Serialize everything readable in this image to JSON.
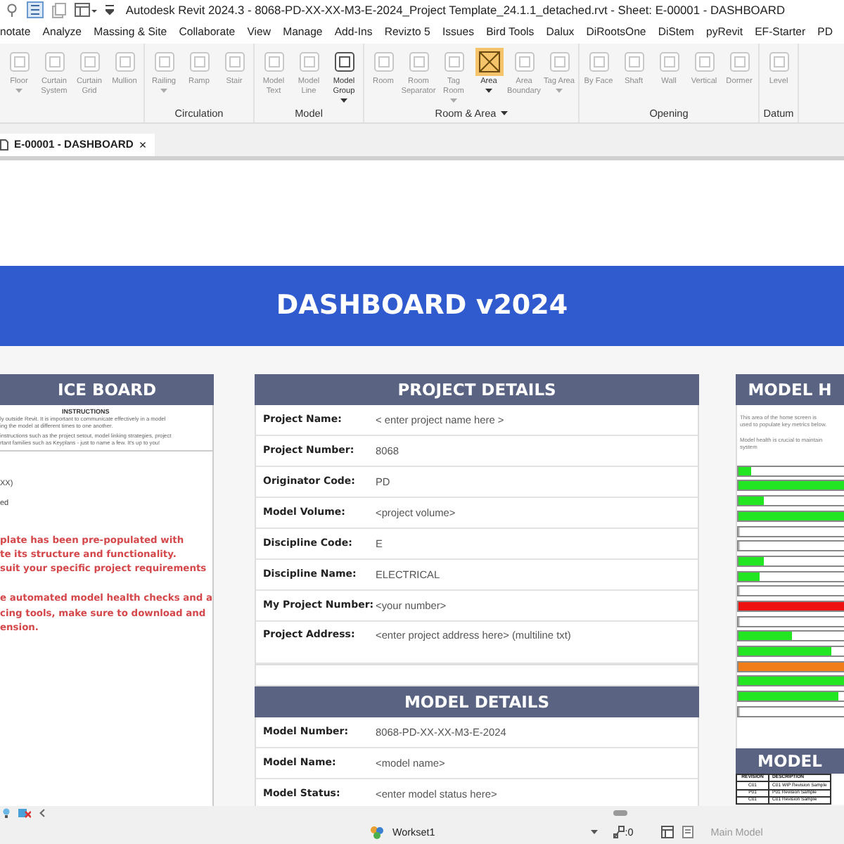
{
  "window": {
    "title": "Autodesk Revit 2024.3 - 8068-PD-XX-XX-M3-E-2024_Project Template_24.1.1_detached.rvt - Sheet: E-00001 - DASHBOARD"
  },
  "menu_tabs": [
    "notate",
    "Analyze",
    "Massing & Site",
    "Collaborate",
    "View",
    "Manage",
    "Add-Ins",
    "Revizto 5",
    "Issues",
    "Bird Tools",
    "Dalux",
    "DiRootsOne",
    "DiStem",
    "pyRevit",
    "EF-Starter",
    "PD"
  ],
  "ribbon": {
    "groups": [
      {
        "items": [
          {
            "label": "Floor",
            "disabled": true,
            "dropdown": true,
            "highlighted": false
          },
          {
            "label": "Curtain System",
            "disabled": true,
            "dropdown": false,
            "highlighted": false
          },
          {
            "label": "Curtain Grid",
            "disabled": true,
            "dropdown": false,
            "highlighted": false
          },
          {
            "label": "Mullion",
            "disabled": true,
            "dropdown": false,
            "highlighted": false
          }
        ]
      },
      {
        "label": "Circulation",
        "dropdown": false,
        "items": [
          {
            "label": "Railing",
            "disabled": true,
            "dropdown": true,
            "highlighted": false
          },
          {
            "label": "Ramp",
            "disabled": true,
            "dropdown": false,
            "highlighted": false
          },
          {
            "label": "Stair",
            "disabled": true,
            "dropdown": false,
            "highlighted": false
          }
        ]
      },
      {
        "label": "Model",
        "dropdown": false,
        "items": [
          {
            "label": "Model Text",
            "disabled": true,
            "dropdown": false,
            "highlighted": false
          },
          {
            "label": "Model Line",
            "disabled": true,
            "dropdown": false,
            "highlighted": false
          },
          {
            "label": "Model Group",
            "disabled": false,
            "dropdown": true,
            "highlighted": false
          }
        ]
      },
      {
        "label": "Room & Area",
        "dropdown": true,
        "items": [
          {
            "label": "Room",
            "disabled": true,
            "dropdown": false,
            "highlighted": false
          },
          {
            "label": "Room Separator",
            "disabled": true,
            "dropdown": false,
            "highlighted": false
          },
          {
            "label": "Tag Room",
            "disabled": true,
            "dropdown": true,
            "highlighted": false
          },
          {
            "label": "Area",
            "disabled": false,
            "dropdown": true,
            "highlighted": true
          },
          {
            "label": "Area Boundary",
            "disabled": true,
            "dropdown": false,
            "highlighted": false
          },
          {
            "label": "Tag Area",
            "disabled": true,
            "dropdown": true,
            "highlighted": false
          }
        ]
      },
      {
        "label": "Opening",
        "dropdown": false,
        "items": [
          {
            "label": "By Face",
            "disabled": true,
            "dropdown": false,
            "highlighted": false
          },
          {
            "label": "Shaft",
            "disabled": true,
            "dropdown": false,
            "highlighted": false
          },
          {
            "label": "Wall",
            "disabled": true,
            "dropdown": false,
            "highlighted": false
          },
          {
            "label": "Vertical",
            "disabled": true,
            "dropdown": false,
            "highlighted": false
          },
          {
            "label": "Dormer",
            "disabled": true,
            "dropdown": false,
            "highlighted": false
          }
        ]
      },
      {
        "label": "Datum",
        "dropdown": false,
        "items": [
          {
            "label": "Level",
            "disabled": true,
            "dropdown": false,
            "highlighted": false
          }
        ]
      }
    ]
  },
  "document_tabs": [
    {
      "label": "E-00001 - DASHBOARD",
      "close": "×",
      "selected": true
    }
  ],
  "sheet": {
    "banner": "DASHBOARD v2024",
    "notice_board": {
      "title": "ICE BOARD",
      "instructions_heading": "INSTRUCTIONS",
      "instructions": [
        "ly outside Revit. It is important to communicate effectively in a model",
        "ing the model at different times to one another.",
        "instructions such as the project setout, model linking strategies, project",
        "rtant families such as Keyplans - just to name a few. It's up to you!"
      ],
      "notes": [
        "XX)",
        "ed"
      ],
      "warnings": [
        [
          "plate has been pre-populated with",
          "te its structure and functionality.",
          "suit your specific project requirements"
        ],
        [
          "e automated model health checks and a",
          "cing tools, make sure to download and",
          "ension."
        ]
      ]
    },
    "project_details": {
      "title": "PROJECT DETAILS",
      "rows": [
        {
          "label": "Project Name:",
          "value": "< enter project name here >"
        },
        {
          "label": "Project Number:",
          "value": "8068"
        },
        {
          "label": "Originator Code:",
          "value": "PD"
        },
        {
          "label": "Model Volume:",
          "value": "<project volume>"
        },
        {
          "label": "Discipline Code:",
          "value": "E"
        },
        {
          "label": "Discipline Name:",
          "value": "ELECTRICAL"
        },
        {
          "label": "My Project Number:",
          "value": "<your number>"
        },
        {
          "label": "Project Address:",
          "value": "<enter project address here> (multiline txt)"
        }
      ]
    },
    "model_details": {
      "title": "MODEL DETAILS",
      "rows": [
        {
          "label": "Model Number:",
          "value": "8068-PD-XX-XX-M3-E-2024"
        },
        {
          "label": "Model Name:",
          "value": "<model name>"
        },
        {
          "label": "Model Status:",
          "value": "<enter model status here>"
        }
      ]
    },
    "model_health": {
      "title": "MODEL H",
      "intro": [
        "This area of the home screen is",
        "used to populate key metrics below."
      ],
      "note": [
        "Model health is crucial to maintain",
        "system"
      ],
      "bars": [
        {
          "level": 0.12,
          "color": "#22e622"
        },
        {
          "level": 1,
          "color": "#22e622"
        },
        {
          "level": 0.24,
          "color": "#22e622"
        },
        {
          "level": 1,
          "color": "#22e622"
        },
        {
          "level": 0
        },
        {
          "level": 0
        },
        {
          "level": 0.24,
          "color": "#22e622"
        },
        {
          "level": 0.2,
          "color": "#22e622"
        },
        {
          "level": 0
        },
        {
          "level": 1,
          "color": "#ee1111"
        },
        {
          "level": 0
        },
        {
          "level": 0.5,
          "color": "#22e622"
        },
        {
          "level": 0.88,
          "color": "#22e622"
        },
        {
          "level": 1,
          "color": "#f07d1a"
        },
        {
          "level": 1,
          "color": "#22e622"
        },
        {
          "level": 0.94,
          "color": "#22e622"
        },
        {
          "level": 0
        }
      ]
    },
    "model_revisions": {
      "title": "MODEL",
      "columns": [
        "REVISION",
        "DESCRIPTION"
      ],
      "rows": [
        [
          "C01",
          "C01 WIP Revision Sample"
        ],
        [
          "P01",
          "P01 Revision Sample"
        ],
        [
          "C01",
          "C01 Revision Sample"
        ]
      ]
    }
  },
  "status_bar": {
    "workset": "Workset1",
    "element_count": ":0",
    "model": "Main Model",
    "model_disabled": true
  }
}
